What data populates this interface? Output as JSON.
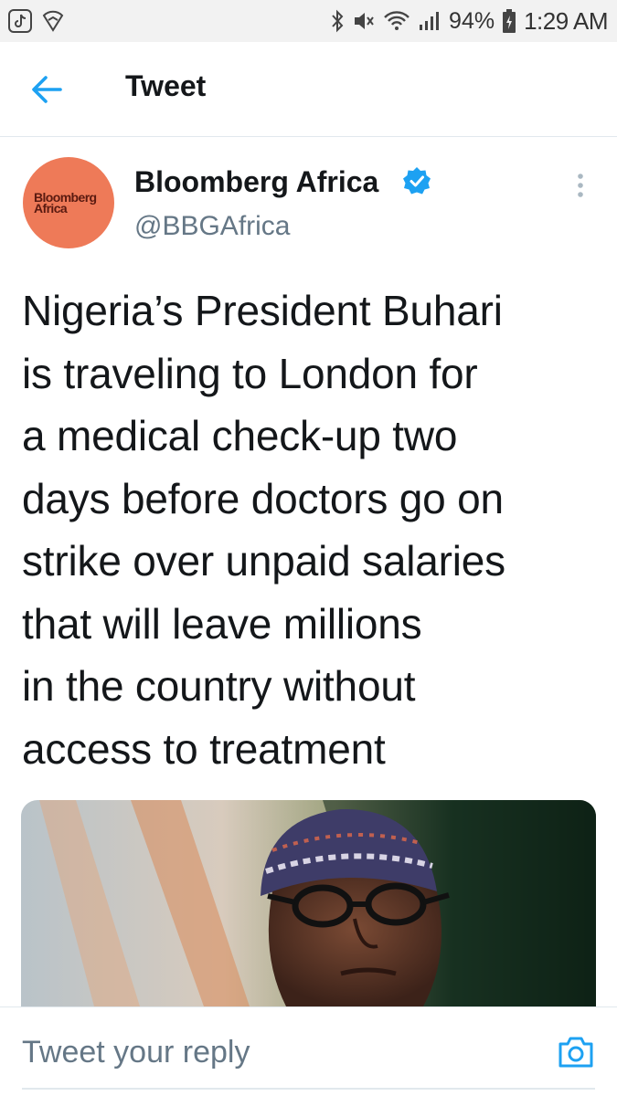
{
  "status_bar": {
    "battery": "94%",
    "time": "1:29 AM",
    "icons": [
      "tiktok-icon",
      "vpn-shield-icon",
      "bluetooth-icon",
      "mute-icon",
      "wifi-icon",
      "signal-icon",
      "battery-charging-icon"
    ]
  },
  "header": {
    "title": "Tweet",
    "back_icon": "arrow-left-icon"
  },
  "tweet": {
    "avatar_text": "Bloomberg\nAfrica",
    "display_name": "Bloomberg Africa",
    "handle": "@BBGAfrica",
    "verified": true,
    "text": "Nigeria’s President Buhari is traveling to London for a medical check-up two days before doctors go on strike over unpaid salaries that will leave millions in the country without access to treatment",
    "text_lines": [
      "Nigeria’s President Buhari",
      "is traveling to London for",
      "a medical check-up two",
      "days before doctors go on",
      "strike over unpaid salaries",
      "that will leave millions",
      "in the country without",
      "access to treatment"
    ]
  },
  "reply": {
    "placeholder": "Tweet your reply",
    "camera_icon": "camera-icon"
  },
  "colors": {
    "accent": "#1da1f2",
    "avatar_bg": "#ee7a58",
    "secondary_text": "#657786"
  }
}
